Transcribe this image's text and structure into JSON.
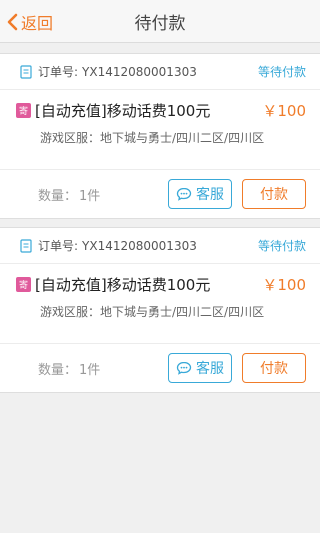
{
  "header": {
    "back_label": "返回",
    "title": "待付款"
  },
  "colors": {
    "accent": "#f07c2a",
    "link": "#39a9d8",
    "badge": "#e05a9b"
  },
  "orders": [
    {
      "order_label": "订单号:",
      "order_no": "YX1412080001303",
      "status": "等待付款",
      "badge": "寄",
      "item_name": "[自动充值]移动话费100元",
      "price": "￥100",
      "server": "游戏区服：地下城与勇士/四川二区/四川区",
      "qty_label": "数量：",
      "qty_value": "1件",
      "service_label": "客服",
      "pay_label": "付款"
    },
    {
      "order_label": "订单号:",
      "order_no": "YX1412080001303",
      "status": "等待付款",
      "badge": "寄",
      "item_name": "[自动充值]移动话费100元",
      "price": "￥100",
      "server": "游戏区服：地下城与勇士/四川二区/四川区",
      "qty_label": "数量：",
      "qty_value": "1件",
      "service_label": "客服",
      "pay_label": "付款"
    }
  ]
}
